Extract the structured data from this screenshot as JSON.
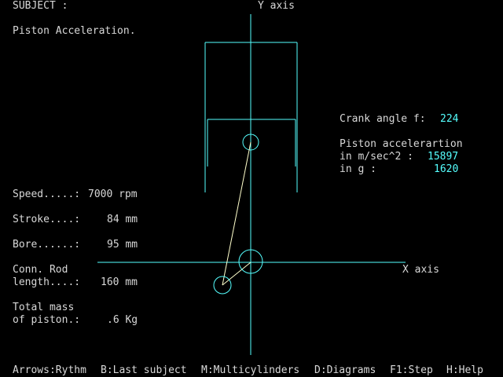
{
  "header": {
    "subject_label": "SUBJECT :",
    "subject_value": "Piston Acceleration.",
    "y_axis_label": "Y axis",
    "x_axis_label": "X axis"
  },
  "params": {
    "speed_label": "Speed.....:",
    "speed_value": "7000 rpm",
    "stroke_label": "Stroke....:",
    "stroke_value": "84 mm",
    "bore_label": "Bore......:",
    "bore_value": "95 mm",
    "conn_rod_label_line1": "Conn. Rod",
    "conn_rod_label_line2": "length....:",
    "conn_rod_value": "160 mm",
    "mass_label_line1": "Total mass",
    "mass_label_line2": "of piston.:",
    "mass_value": ".6 Kg"
  },
  "readout": {
    "crank_angle_label": "Crank angle f:",
    "crank_angle_value": "224",
    "accel_label": "Piston accelerartion",
    "accel_ms2_label": "in m/sec^2 :",
    "accel_ms2_value": "15897",
    "accel_g_label": "in g :",
    "accel_g_value": "1620"
  },
  "menu": {
    "arrows": "Arrows:Rythm",
    "last_subject": "B:Last subject",
    "multicylinders": "M:Multicylinders",
    "diagrams": "D:Diagrams",
    "step": "F1:Step",
    "help": "H:Help"
  },
  "colors": {
    "background": "#000000",
    "text": "#d8d8d8",
    "value": "#55ffff",
    "drawing": "#55ffff"
  }
}
